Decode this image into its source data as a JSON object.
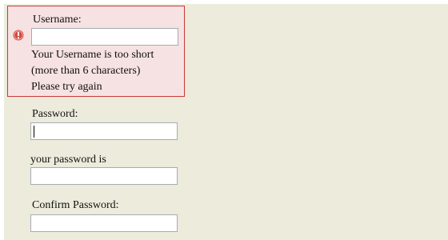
{
  "form": {
    "username": {
      "label": "Username:",
      "value": "",
      "error_lines": [
        "Your Username is too short",
        "(more than 6 characters)",
        "Please try again"
      ],
      "icon": "error-exclamation-icon",
      "error_border_color": "#c53a3a",
      "error_background": "#f6e2e2"
    },
    "password": {
      "label": "Password:",
      "value": ""
    },
    "password_hint": {
      "label": "your password is",
      "value": ""
    },
    "confirm_password": {
      "label": "Confirm Password:",
      "value": ""
    }
  },
  "colors": {
    "panel_background": "#ecebdc",
    "input_border": "#a5acb2"
  }
}
